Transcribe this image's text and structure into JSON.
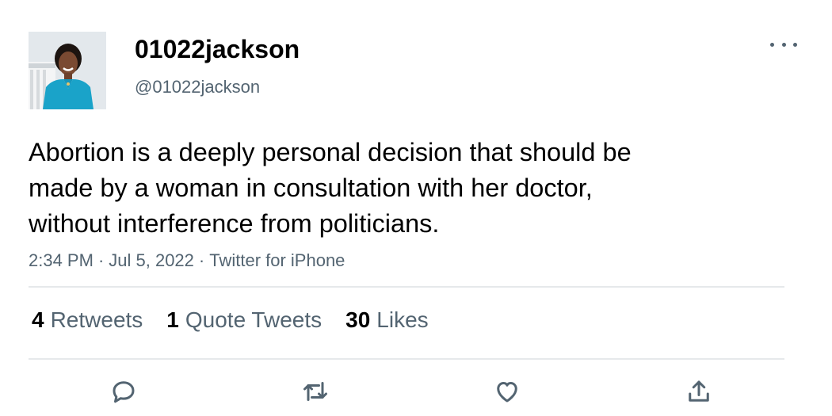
{
  "tweet": {
    "display_name": "01022jackson",
    "handle": "@01022jackson",
    "text": "Abortion is a deeply personal decision that should be\nmade by a woman in consultation with her doctor,\nwithout interference from politicians.",
    "time": "2:34 PM",
    "date": "Jul 5, 2022",
    "source": "Twitter for iPhone",
    "sep": "·"
  },
  "stats": {
    "retweets_count": "4",
    "retweets_label": "Retweets",
    "quotes_count": "1",
    "quotes_label": "Quote Tweets",
    "likes_count": "30",
    "likes_label": "Likes"
  },
  "icons": {
    "more": "more-options-icon",
    "reply": "reply-icon",
    "retweet": "retweet-icon",
    "like": "heart-icon",
    "share": "share-icon"
  },
  "colors": {
    "secondary_text": "#536471",
    "primary_text": "#000000",
    "divider": "#e6e9eb",
    "avatar_jacket": "#1aa3c9"
  }
}
